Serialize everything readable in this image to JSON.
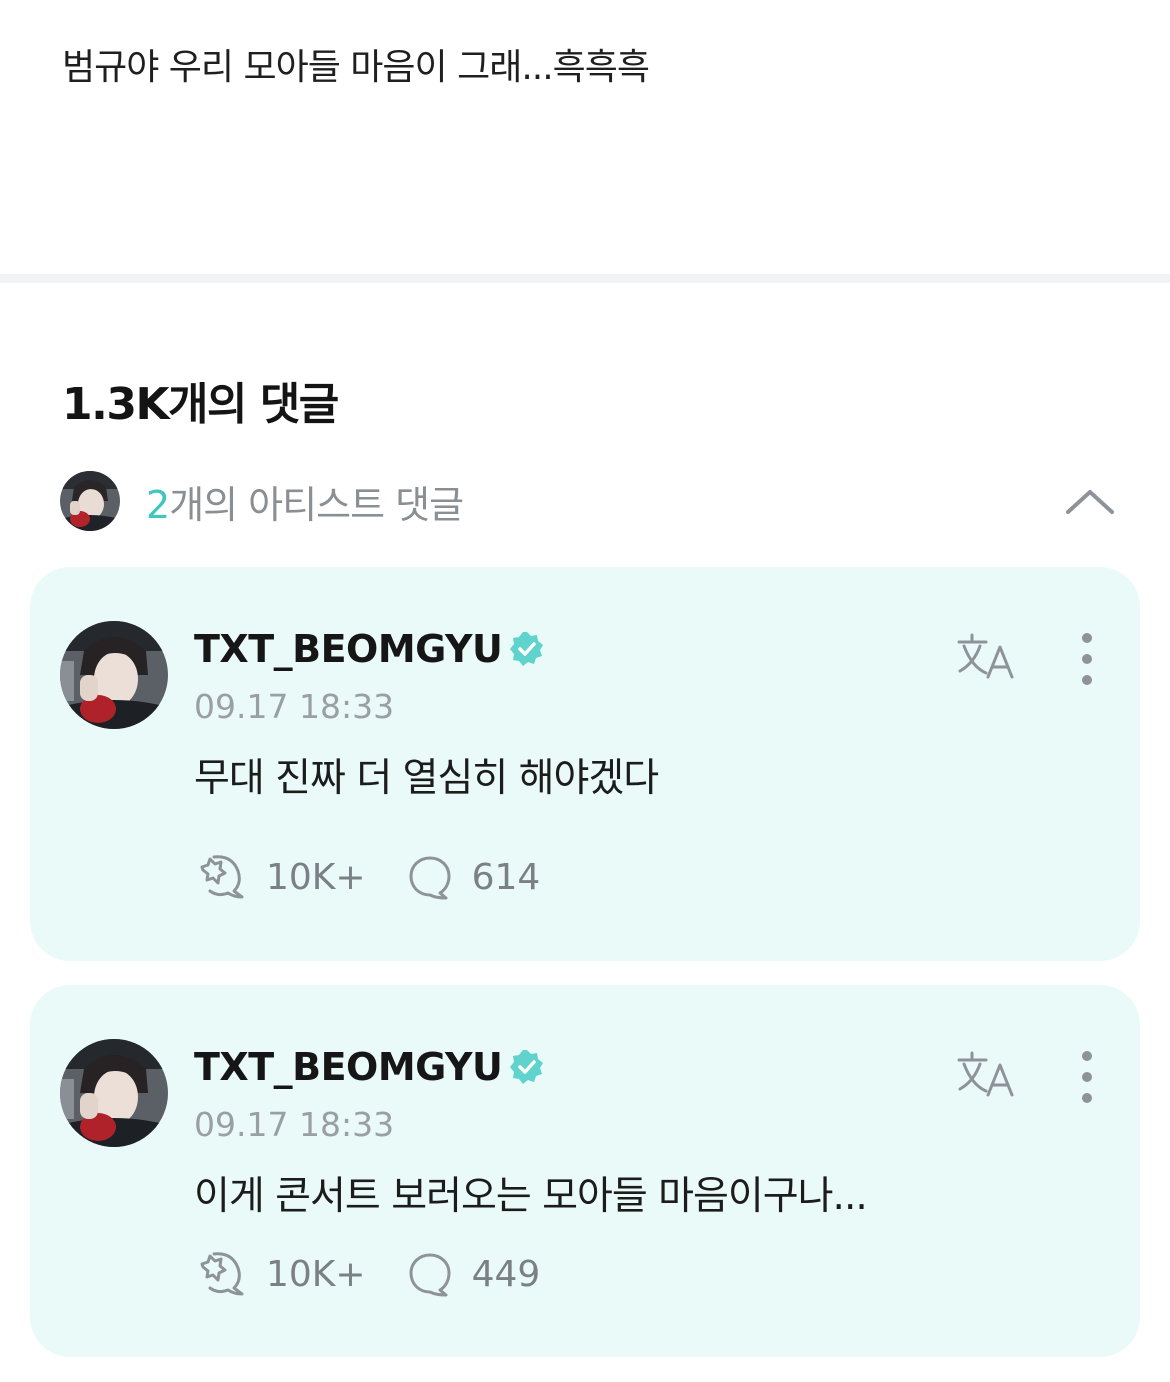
{
  "post": {
    "text": "범규야 우리 모아들 마음이 그래...흑흑흑"
  },
  "comments_header": {
    "count_label": "1.3K개의 댓글"
  },
  "artist_comments": {
    "count": "2",
    "label_suffix": "개의 아티스트 댓글",
    "expanded": true
  },
  "comments": [
    {
      "username": "TXT_BEOMGYU",
      "verified": true,
      "timestamp": "09.17 18:33",
      "text": "무대 진짜 더 열심히 해야겠다",
      "likes": "10K+",
      "replies": "614"
    },
    {
      "username": "TXT_BEOMGYU",
      "verified": true,
      "timestamp": "09.17 18:33",
      "text": "이게 콘서트 보러오는 모아들 마음이구나...",
      "likes": "10K+",
      "replies": "449"
    }
  ],
  "colors": {
    "accent": "#3ec6c0",
    "card_bg": "#eafaf8",
    "verified_badge": "#5fd3cc",
    "muted_text": "#9a9fa4"
  },
  "icons": {
    "verified": "verified-badge-icon",
    "translate": "translate-icon",
    "more": "more-vertical-icon",
    "like": "like-icon",
    "reply": "comment-bubble-icon",
    "collapse": "chevron-up-icon"
  }
}
